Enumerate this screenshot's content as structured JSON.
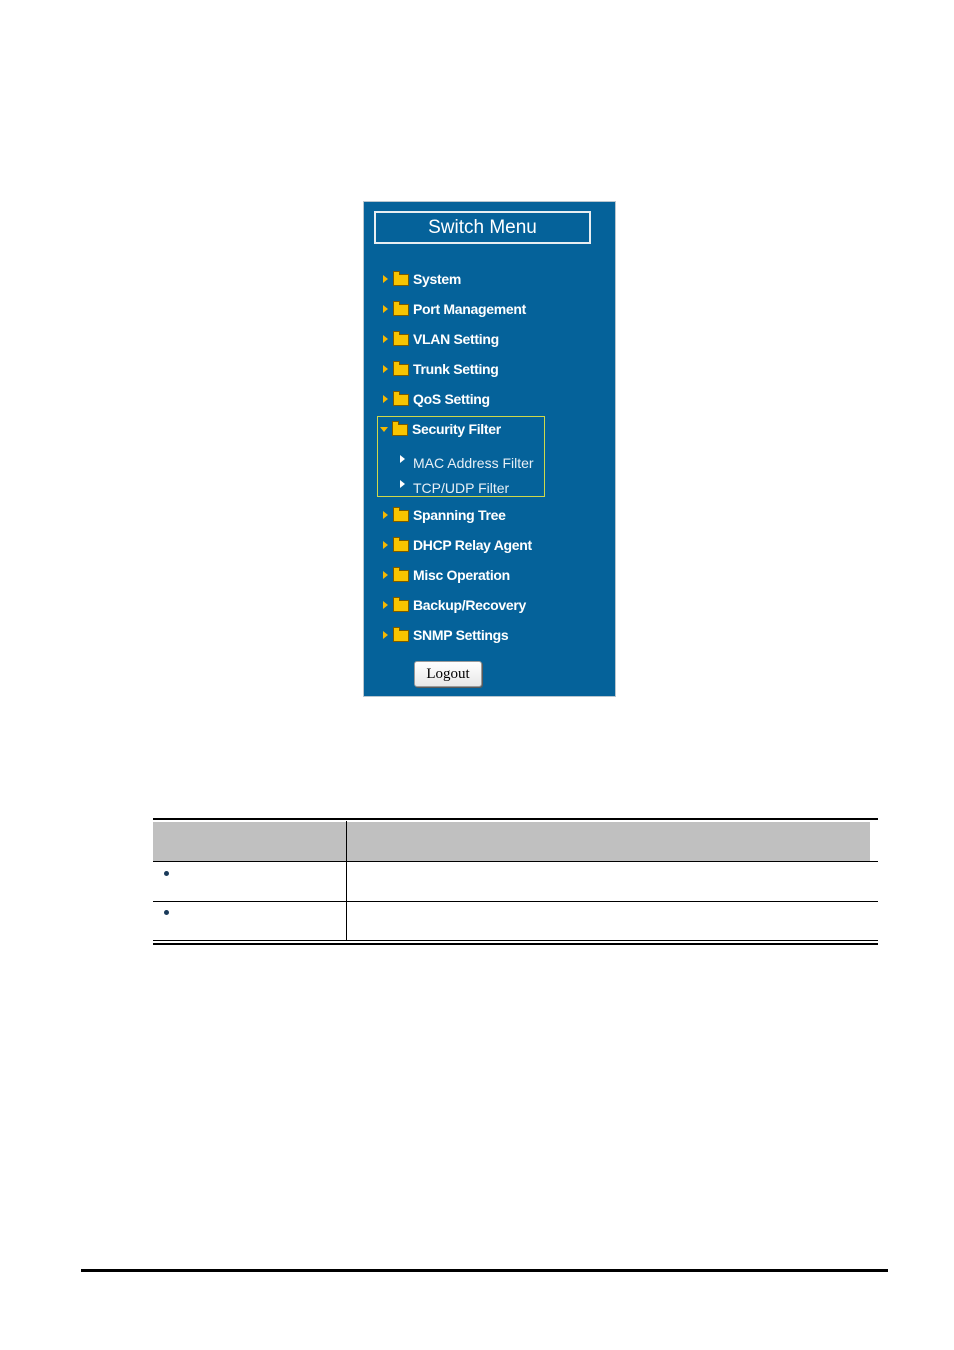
{
  "menu": {
    "title": "Switch Menu",
    "colors": {
      "background": "#05629a",
      "arrow": "#f6b800",
      "folder": "#f8c400",
      "highlight_border": "#cfd84a"
    },
    "items": [
      {
        "label": "System",
        "expanded": false
      },
      {
        "label": "Port Management",
        "expanded": false
      },
      {
        "label": "VLAN Setting",
        "expanded": false
      },
      {
        "label": "Trunk Setting",
        "expanded": false
      },
      {
        "label": "QoS Setting",
        "expanded": false
      },
      {
        "label": "Security Filter",
        "expanded": true,
        "children": [
          {
            "label": "MAC Address Filter"
          },
          {
            "label": "TCP/UDP Filter"
          }
        ]
      },
      {
        "label": "Spanning Tree",
        "expanded": false
      },
      {
        "label": "DHCP Relay Agent",
        "expanded": false
      },
      {
        "label": "Misc Operation",
        "expanded": false
      },
      {
        "label": "Backup/Recovery",
        "expanded": false
      },
      {
        "label": "SNMP Settings",
        "expanded": false
      }
    ],
    "logout_label": "Logout"
  },
  "table": {
    "headers": [
      "",
      ""
    ],
    "rows": [
      {
        "name": "",
        "description": ""
      },
      {
        "name": "",
        "description": ""
      }
    ]
  }
}
